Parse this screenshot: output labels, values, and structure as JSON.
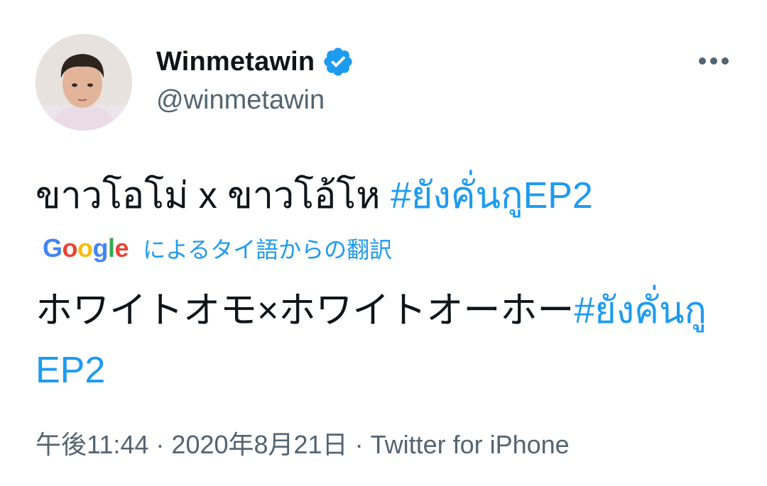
{
  "author": {
    "display_name": "Winmetawin",
    "handle": "@winmetawin",
    "verified": true,
    "avatar_icon": "profile-photo"
  },
  "tweet": {
    "text_prefix": "ขาวโอโม่ x ขาวโอ้โห ",
    "hashtag": "#ยังคั่นกูEP2"
  },
  "translation": {
    "provider": "Google",
    "label": "によるタイ語からの翻訳",
    "text_prefix": "ホワイトオモ×ホワイトオーホー",
    "hashtag": "#ยังคั่นกูEP2"
  },
  "meta": {
    "time": "午後11:44",
    "separator": "·",
    "date": "2020年8月21日",
    "source": "Twitter for iPhone"
  },
  "colors": {
    "link": "#1d9bf0",
    "secondary": "#536471",
    "verified": "#1d9bf0"
  },
  "icons": {
    "more": "more-horizontal-icon",
    "verified": "verified-badge-icon"
  }
}
